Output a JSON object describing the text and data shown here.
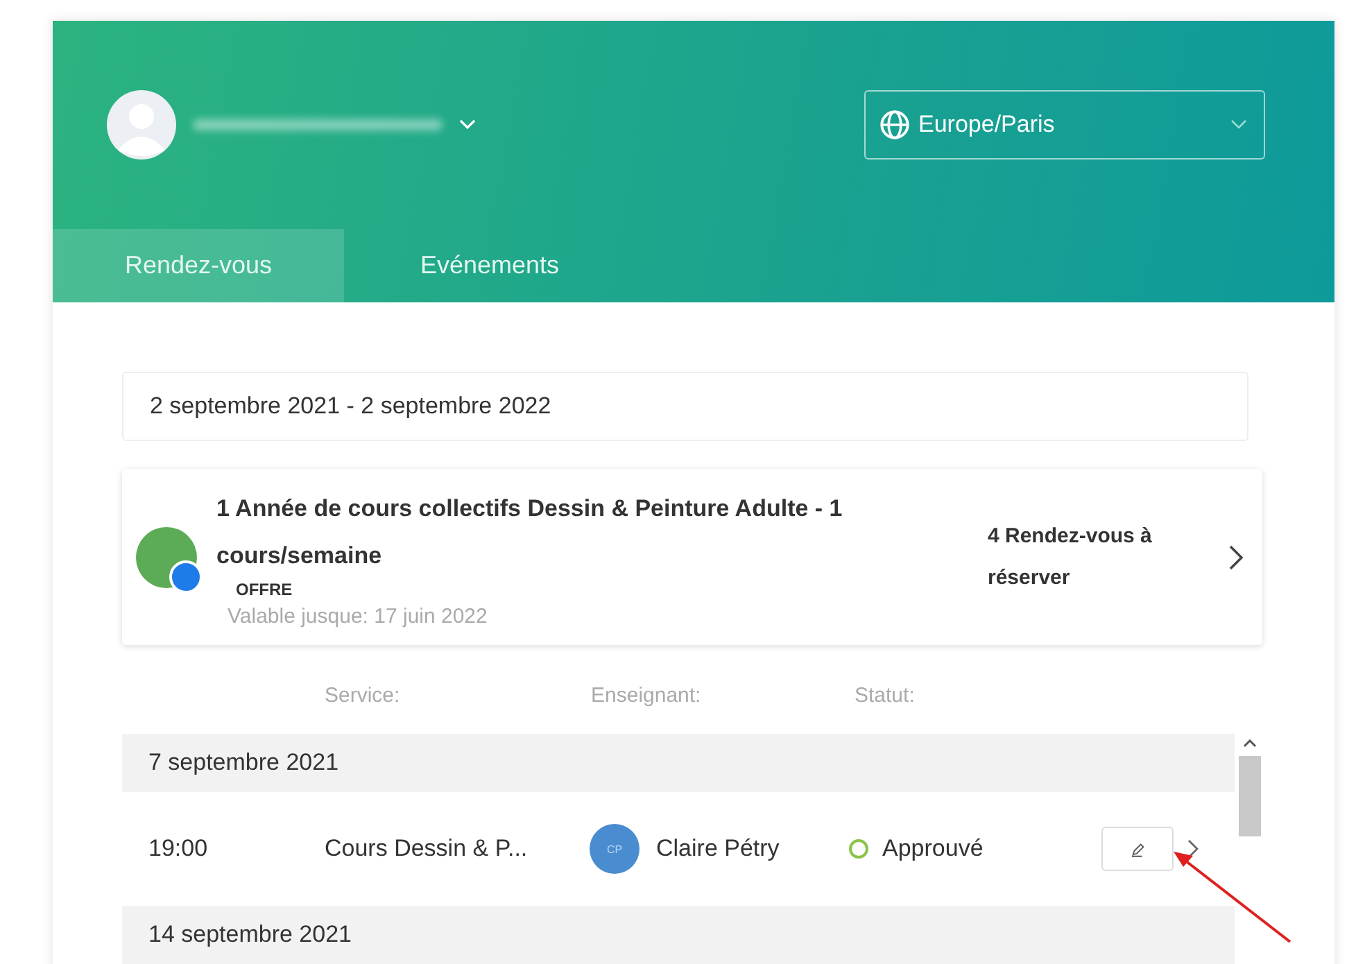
{
  "header": {
    "timezone": "Europe/Paris"
  },
  "tabs": [
    {
      "label": "Rendez-vous",
      "selected": true
    },
    {
      "label": "Evénements",
      "selected": false
    }
  ],
  "period": "2 septembre 2021 - 2 septembre 2022",
  "offer": {
    "title": "1 Année de cours collectifs Dessin & Peinture Adulte - 1 cours/semaine",
    "badge": "OFFRE",
    "validity": "Valable jusque: 17 juin 2022",
    "remaining": "4 Rendez-vous à réserver"
  },
  "table": {
    "columns": [
      "Service:",
      "Enseignant:",
      "Statut:"
    ],
    "groups": [
      {
        "date": "7 septembre 2021",
        "rows": [
          {
            "time": "19:00",
            "service": "Cours Dessin & P...",
            "teacher_initials": "CP",
            "teacher": "Claire Pétry",
            "status": "Approuvé",
            "color": "#8bc34a"
          }
        ]
      },
      {
        "date": "14 septembre 2021"
      }
    ]
  }
}
